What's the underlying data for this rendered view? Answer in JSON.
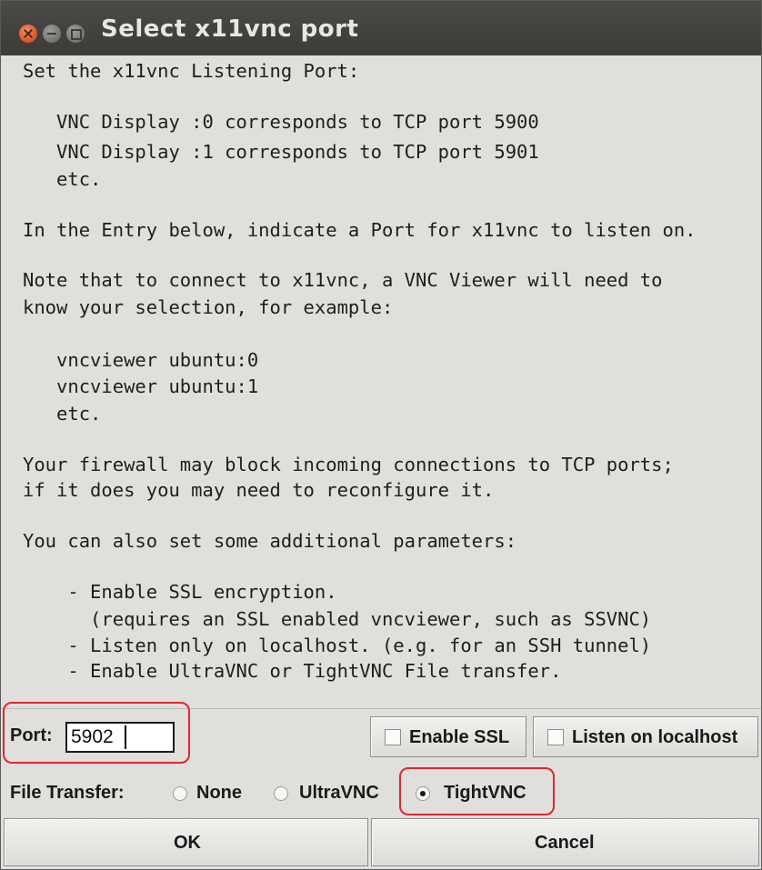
{
  "window": {
    "title": "Select x11vnc port"
  },
  "message": {
    "lines": [
      "Set the x11vnc Listening Port:",
      "",
      "   VNC Display :0 corresponds to TCP port 5900",
      "   VNC Display :1 corresponds to TCP port 5901",
      "   etc.",
      "",
      "In the Entry below, indicate a Port for x11vnc to listen on.",
      "",
      "Note that to connect to x11vnc, a VNC Viewer will need to",
      "know your selection, for example:",
      "",
      "   vncviewer ubuntu:0",
      "   vncviewer ubuntu:1",
      "   etc.",
      "",
      "Your firewall may block incoming connections to TCP ports;",
      "if it does you may need to reconfigure it.",
      "",
      "You can also set some additional parameters:",
      "",
      "    - Enable SSL encryption.",
      "      (requires an SSL enabled vncviewer, such as SSVNC)",
      "    - Listen only on localhost. (e.g. for an SSH tunnel)",
      "    - Enable UltraVNC or TightVNC File transfer."
    ]
  },
  "port": {
    "label": "Port:",
    "value": "5902"
  },
  "options": {
    "enable_ssl": {
      "label": "Enable SSL",
      "checked": false
    },
    "listen_localhost": {
      "label": "Listen on localhost",
      "checked": false
    }
  },
  "file_transfer": {
    "label": "File Transfer:",
    "options": [
      {
        "label": "None",
        "selected": false
      },
      {
        "label": "UltraVNC",
        "selected": false
      },
      {
        "label": "TightVNC",
        "selected": true
      }
    ]
  },
  "buttons": {
    "ok": "OK",
    "cancel": "Cancel"
  },
  "colors": {
    "titlebar": "#3c3b37",
    "background": "#e0dfdc",
    "highlight": "#e0262e"
  }
}
